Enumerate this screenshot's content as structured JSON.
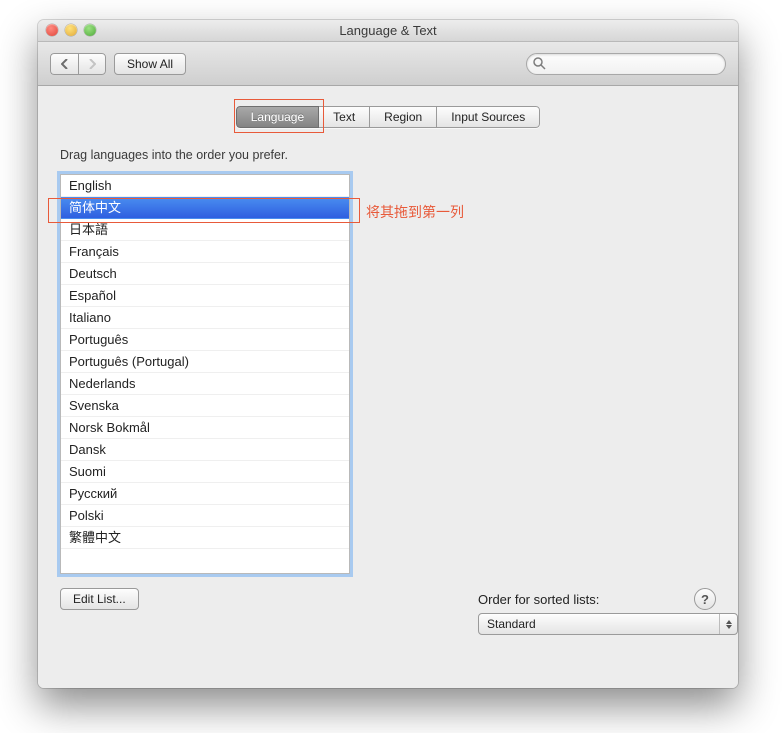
{
  "window": {
    "title": "Language & Text"
  },
  "toolbar": {
    "show_all_label": "Show All",
    "search_placeholder": ""
  },
  "tabs": {
    "items": [
      "Language",
      "Text",
      "Region",
      "Input Sources"
    ],
    "active_index": 0
  },
  "instruction": "Drag languages into the order you prefer.",
  "languages": [
    "English",
    "简体中文",
    "日本語",
    "Français",
    "Deutsch",
    "Español",
    "Italiano",
    "Português",
    "Português (Portugal)",
    "Nederlands",
    "Svenska",
    "Norsk Bokmål",
    "Dansk",
    "Suomi",
    "Русский",
    "Polski",
    "繁體中文"
  ],
  "selected_language_index": 1,
  "sort": {
    "label": "Order for sorted lists:",
    "value": "Standard"
  },
  "buttons": {
    "edit_list": "Edit List..."
  },
  "help": "?",
  "annotation": {
    "drag_hint": "将其拖到第一列"
  }
}
